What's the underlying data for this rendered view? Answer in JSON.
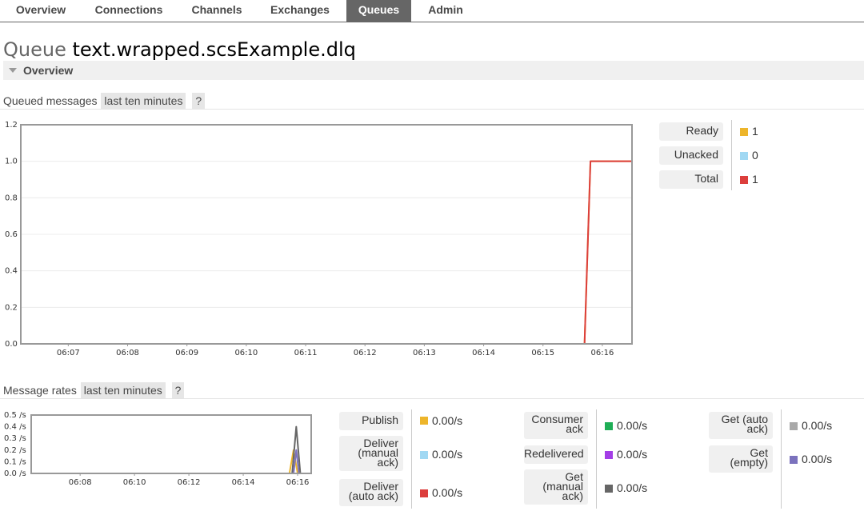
{
  "tabs": [
    {
      "label": "Overview"
    },
    {
      "label": "Connections"
    },
    {
      "label": "Channels"
    },
    {
      "label": "Exchanges"
    },
    {
      "label": "Queues",
      "active": true
    },
    {
      "label": "Admin"
    }
  ],
  "page": {
    "title_kind": "Queue",
    "title_name": "text.wrapped.scsExample.dlq",
    "section": "Overview"
  },
  "queued_messages": {
    "title": "Queued messages",
    "range": "last ten minutes",
    "help": "?",
    "legend": [
      {
        "label": "Ready",
        "value": "1",
        "color": "#edb52b"
      },
      {
        "label": "Unacked",
        "value": "0",
        "color": "#a0d8f3"
      },
      {
        "label": "Total",
        "value": "1",
        "color": "#dc3e3c"
      }
    ]
  },
  "message_rates": {
    "title": "Message rates",
    "range": "last ten minutes",
    "help": "?",
    "legend_col1": [
      {
        "label": "Publish",
        "value": "0.00/s",
        "color": "#edb52b"
      },
      {
        "label": "Deliver\n(manual\nack)",
        "value": "0.00/s",
        "color": "#a0d8f3"
      },
      {
        "label": "Deliver\n(auto ack)",
        "value": "0.00/s",
        "color": "#dc3e3c"
      }
    ],
    "legend_col2": [
      {
        "label": "Consumer\nack",
        "value": "0.00/s",
        "color": "#1fae56"
      },
      {
        "label": "Redelivered",
        "value": "0.00/s",
        "color": "#a33ee6"
      },
      {
        "label": "Get\n(manual\nack)",
        "value": "0.00/s",
        "color": "#666666"
      }
    ],
    "legend_col3": [
      {
        "label": "Get (auto\nack)",
        "value": "0.00/s",
        "color": "#a9a9a9"
      },
      {
        "label": "Get\n(empty)",
        "value": "0.00/s",
        "color": "#7b72bd"
      }
    ]
  },
  "chart_data": [
    {
      "type": "line",
      "title": "Queued messages",
      "x_ticks": [
        "06:07",
        "06:08",
        "06:09",
        "06:10",
        "06:11",
        "06:12",
        "06:13",
        "06:14",
        "06:15",
        "06:16"
      ],
      "ylim": [
        0,
        1.2
      ],
      "y_ticks": [
        "0.0",
        "0.2",
        "0.4",
        "0.6",
        "0.8",
        "1.0",
        "1.2"
      ],
      "grid": true,
      "series": [
        {
          "name": "Ready",
          "color": "#edb52b",
          "x_minutes": [
            6.2,
            15.7,
            15.8,
            16.5
          ],
          "values": [
            0,
            0,
            1,
            1
          ]
        },
        {
          "name": "Unacked",
          "color": "#a0d8f3",
          "x_minutes": [
            6.2,
            15.8,
            16.5
          ],
          "values": [
            0,
            0,
            0
          ]
        },
        {
          "name": "Total",
          "color": "#dc3e3c",
          "x_minutes": [
            6.2,
            15.7,
            15.8,
            16.5
          ],
          "values": [
            0,
            0,
            1,
            1
          ]
        }
      ]
    },
    {
      "type": "line",
      "title": "Message rates",
      "x_ticks": [
        "06:08",
        "06:10",
        "06:12",
        "06:14",
        "06:16"
      ],
      "ylim": [
        0,
        0.5
      ],
      "y_ticks": [
        "0.0 /s",
        "0.1 /s",
        "0.2 /s",
        "0.3 /s",
        "0.4 /s",
        "0.5 /s"
      ],
      "grid": false,
      "series": [
        {
          "name": "Publish",
          "color": "#edb52b",
          "x_minutes": [
            6.2,
            15.7,
            15.85,
            16.0,
            16.5
          ],
          "values": [
            0,
            0,
            0.2,
            0,
            0
          ]
        },
        {
          "name": "Get (manual ack)",
          "color": "#666666",
          "x_minutes": [
            6.2,
            15.8,
            15.95,
            16.1,
            16.5
          ],
          "values": [
            0,
            0,
            0.4,
            0,
            0
          ]
        },
        {
          "name": "Get (empty)",
          "color": "#7b72bd",
          "x_minutes": [
            6.2,
            15.85,
            15.95,
            16.05,
            16.5
          ],
          "values": [
            0,
            0,
            0.2,
            0,
            0
          ]
        }
      ]
    }
  ]
}
